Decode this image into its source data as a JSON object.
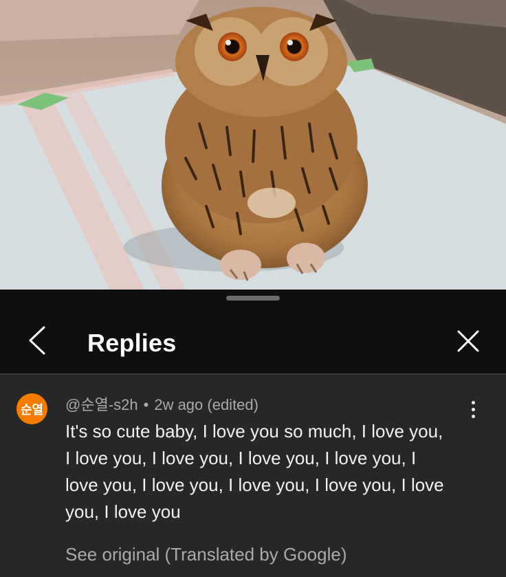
{
  "header": {
    "title": "Replies",
    "back_icon": "chevron-left-icon",
    "close_icon": "close-icon"
  },
  "comment": {
    "avatar_text": "순열",
    "avatar_color": "#f57c00",
    "author": "@순열-s2h",
    "separator": "•",
    "timestamp": "2w ago (edited)",
    "text": "It's so cute baby, I love you so much, I love you, I love you, I love you, I love you, I love you, I love you, I love you, I love you, I love you, I love you, I love you",
    "translation_link": "See original (Translated by Google)",
    "more_icon": "more-vertical-icon"
  }
}
